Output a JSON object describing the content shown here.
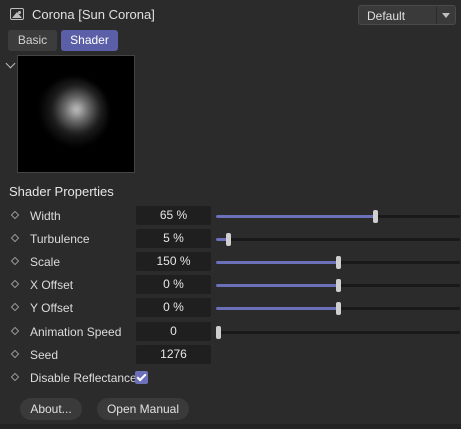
{
  "header": {
    "title": "Corona [Sun Corona]",
    "preset": "Default",
    "icon": "image-icon"
  },
  "tabs": [
    {
      "label": "Basic",
      "active": false
    },
    {
      "label": "Shader",
      "active": true
    }
  ],
  "section_title": "Shader Properties",
  "properties": [
    {
      "label": "Width",
      "value": "65 %",
      "slider": 0.65
    },
    {
      "label": "Turbulence",
      "value": "5 %",
      "slider": 0.05
    },
    {
      "label": "Scale",
      "value": "150 %",
      "slider": 0.5
    },
    {
      "label": "X Offset",
      "value": "0 %",
      "slider": 0.5
    },
    {
      "label": "Y Offset",
      "value": "0 %",
      "slider": 0.5
    },
    {
      "label": "Animation Speed",
      "value": "0",
      "slider": 0.0
    },
    {
      "label": "Seed",
      "value": "1276"
    },
    {
      "label": "Disable Reflectance",
      "checked": true
    }
  ],
  "buttons": {
    "about": "About...",
    "manual": "Open Manual"
  },
  "colors": {
    "accent": "#5a5fa8",
    "slider_fill": "#6c70b8"
  }
}
